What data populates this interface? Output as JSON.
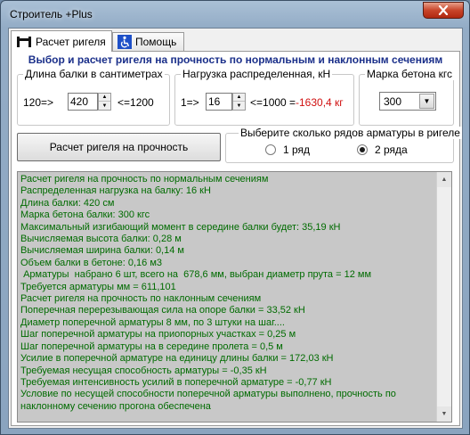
{
  "window": {
    "title": "Строитель +Plus"
  },
  "tabs": [
    {
      "label": "Расчет ригеля",
      "icon": "beam-icon"
    },
    {
      "label": "Помощь",
      "icon": "wheelchair-icon"
    }
  ],
  "heading": "Выбор и расчет ригеля на прочность по нормальным и наклонным сечениям",
  "length_group": {
    "legend": "Длина балки в сантиметрах",
    "min_label": "120=>",
    "value": "420",
    "max_label": "<=1200"
  },
  "load_group": {
    "legend": "Нагрузка распределенная, кН",
    "min_label": "1=>",
    "value": "16",
    "max_label": "<=1000 =",
    "result": "-1630,4",
    "unit": "кг"
  },
  "concrete_group": {
    "legend": "Марка бетона кгс",
    "value": "300"
  },
  "calc_button": "Расчет ригеля на прочность",
  "rows_group": {
    "legend": "Выберите сколько рядов арматуры в ригеле",
    "options": [
      "1 ряд",
      "2 ряда"
    ],
    "selected": "2 ряда"
  },
  "colors": {
    "output_text": "#006b00",
    "heading": "#1a2f8a",
    "negative": "#d01010"
  },
  "output_lines": [
    "Расчет ригеля на прочность по нормальным сечениям",
    "Распределенная нагрузка на балку: 16 кН",
    "Длина балки: 420 см",
    "Марка бетона балки: 300 кгс",
    "Максимальный изгибающий момент в середине балки будет: 35,19 кН",
    "Вычисляемая высота балки: 0,28 м",
    "Вычисляемая ширина балки: 0,14 м",
    "Объем балки в бетоне: 0,16 м3",
    " Арматуры  набрано 6 шт, всего на  678,6 мм, выбран диаметр прута = 12 мм",
    "Требуется арматуры мм = 611,101",
    "Расчет ригеля на прочность по наклонным сечениям",
    "Поперечная перерезывающая сила на опоре балки = 33,52 кН",
    "Диаметр поперечной арматуры 8 мм, по 3 штуки на шаг....",
    "Шаг поперечной арматуры на приопорных участках = 0,25 м",
    "Шаг поперечной арматуры на в середине пролета = 0,5 м",
    "Усилие в поперечной арматуре на единицу длины балки = 172,03 кН",
    "Требуемая несущая способность арматуры = -0,35 кН",
    "Требуемая интенсивность усилий в поперечной арматуре = -0,77 кН",
    "Условие по несущей способности поперечной арматуры выполнено, прочность по наклонному сечению прогона обеспечена"
  ]
}
